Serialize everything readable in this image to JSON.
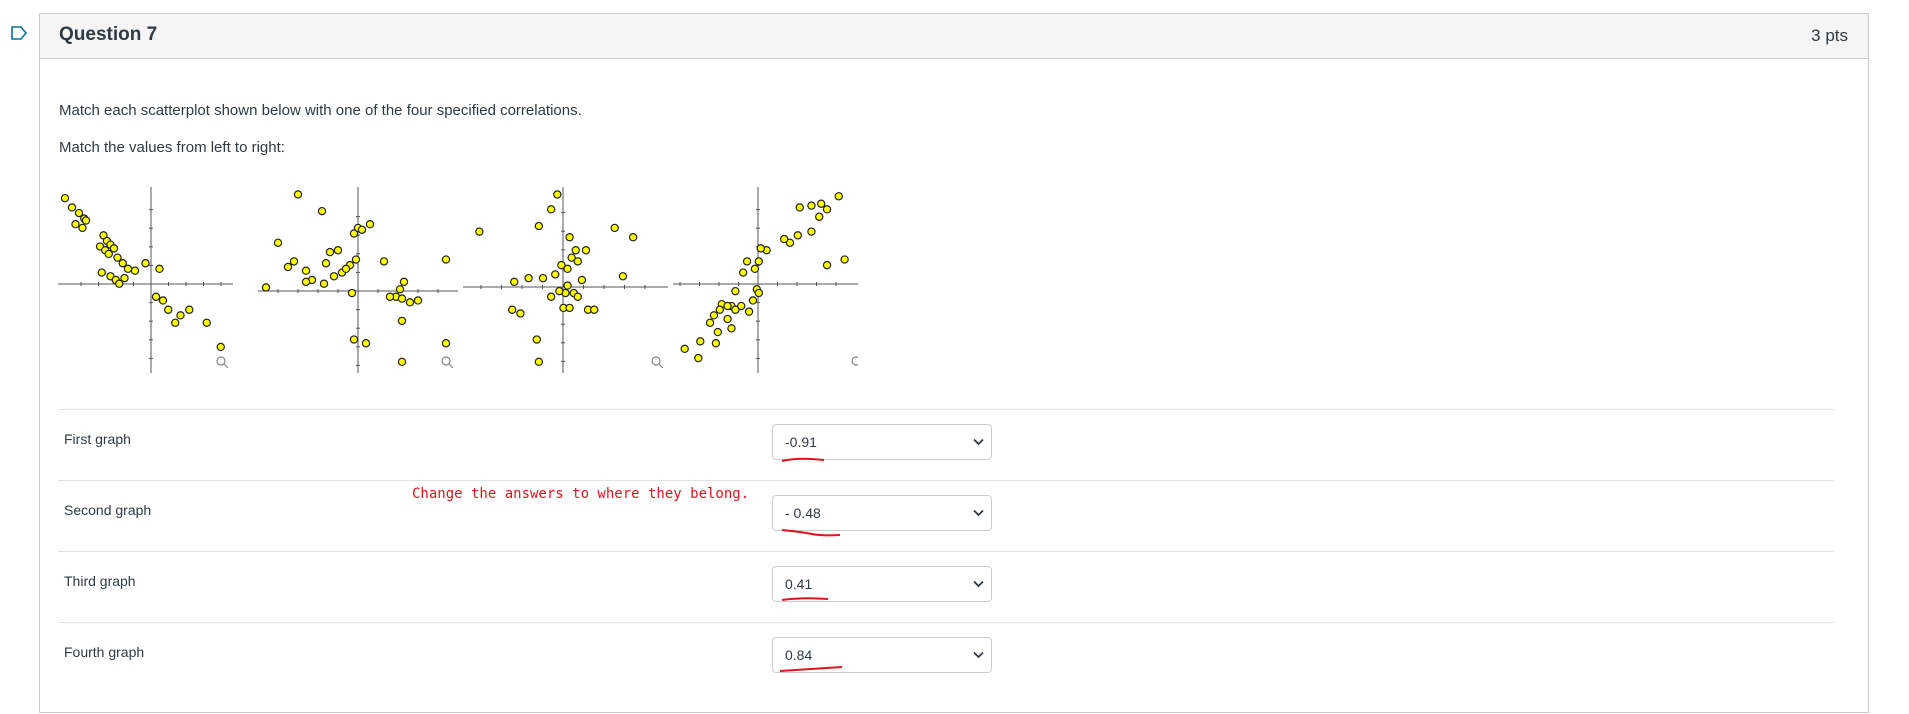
{
  "question": {
    "title": "Question 7",
    "points": "3 pts",
    "prompt": "Match each scatterplot shown below with one of the four specified correlations.",
    "instruction": "Match the values from left to right:"
  },
  "rows": [
    {
      "label": "First graph",
      "selected": "-0.91"
    },
    {
      "label": "Second graph",
      "selected": "- 0.48"
    },
    {
      "label": "Third graph",
      "selected": "0.41"
    },
    {
      "label": "Fourth graph",
      "selected": "0.84"
    }
  ],
  "annotation": {
    "note": "Change the answers to where they belong.",
    "color": "#e1141b"
  },
  "colors": {
    "point_fill": "#ffff00",
    "point_stroke": "#222222",
    "flag": "#0770a3"
  },
  "icons": [
    "flag-icon",
    "chevron-down-icon",
    "magnifier-icon"
  ],
  "chart_data": [
    {
      "type": "scatter",
      "title": "",
      "xlabel": "",
      "ylabel": "",
      "xlim": [
        -5,
        5
      ],
      "ylim": [
        -5,
        5
      ],
      "grid": false,
      "x": [
        -4.6,
        -4.2,
        -3.8,
        -3.5,
        -4.0,
        -3.6,
        -3.4,
        -2.4,
        -2.2,
        -2.0,
        -2.6,
        -2.3,
        -1.8,
        -2.1,
        -1.6,
        -1.3,
        -1.0,
        -2.5,
        -2.0,
        -1.7,
        -1.5,
        -1.2,
        -0.6,
        0.0,
        0.8,
        0.6,
        1.0,
        1.3,
        2.0,
        2.5,
        1.7,
        3.5,
        4.3
      ],
      "y": [
        4.4,
        3.9,
        3.6,
        3.3,
        3.0,
        2.8,
        3.2,
        2.4,
        2.1,
        1.9,
        1.8,
        1.6,
        1.7,
        1.4,
        1.2,
        0.9,
        0.6,
        0.4,
        0.2,
        0.0,
        -0.2,
        0.1,
        0.5,
        0.9,
        0.6,
        -0.9,
        -1.1,
        -1.6,
        -1.9,
        -1.6,
        -2.3,
        -2.3,
        -3.6
      ]
    },
    {
      "type": "scatter",
      "title": "",
      "xlabel": "",
      "ylabel": "",
      "xlim": [
        -5,
        5
      ],
      "ylim": [
        -5,
        5
      ],
      "grid": false,
      "x": [
        -3.0,
        -1.8,
        -4.0,
        -3.5,
        -3.2,
        -2.6,
        -2.3,
        -1.6,
        -1.4,
        -1.0,
        -0.8,
        -0.4,
        -0.2,
        0.0,
        0.2,
        0.6,
        -1.2,
        -0.6,
        -0.1,
        -2.6,
        -1.7,
        -0.3,
        1.3,
        2.3,
        2.1,
        1.9,
        2.2,
        2.6,
        3.0,
        4.4,
        1.6,
        2.2,
        -0.2,
        0.4,
        2.2,
        4.4,
        -4.6
      ],
      "y": [
        4.6,
        3.7,
        2.0,
        0.7,
        1.0,
        0.5,
        0.0,
        0.9,
        1.5,
        1.6,
        0.4,
        0.8,
        2.5,
        2.8,
        2.7,
        3.0,
        0.2,
        0.6,
        1.1,
        -0.1,
        -0.2,
        -0.7,
        1.0,
        -0.1,
        -0.5,
        -0.9,
        -1.0,
        -1.2,
        -1.1,
        1.1,
        -0.9,
        -2.2,
        -3.2,
        -3.4,
        -4.4,
        -3.4,
        -0.4
      ]
    },
    {
      "type": "scatter",
      "title": "",
      "xlabel": "",
      "ylabel": "",
      "xlim": [
        -5,
        5
      ],
      "ylim": [
        -5,
        5
      ],
      "grid": false,
      "x": [
        -4.2,
        -1.3,
        -0.7,
        -0.4,
        0.2,
        0.5,
        1.0,
        2.4,
        3.3,
        0.3,
        0.6,
        0.1,
        -0.2,
        -0.5,
        -1.1,
        -1.8,
        -2.5,
        0.8,
        2.8,
        0.1,
        0.0,
        -0.3,
        0.4,
        0.6,
        -0.7,
        -0.1,
        0.2,
        1.1,
        1.4,
        -2.2,
        -2.6,
        -1.4,
        -1.3
      ],
      "y": [
        2.6,
        2.9,
        3.8,
        4.6,
        2.3,
        1.6,
        1.6,
        2.8,
        2.3,
        1.2,
        1.0,
        0.6,
        0.8,
        0.3,
        0.1,
        0.1,
        -0.1,
        0.0,
        0.2,
        -0.3,
        -0.7,
        -0.6,
        -0.7,
        -0.9,
        -0.9,
        -1.5,
        -1.5,
        -1.6,
        -1.6,
        -1.8,
        -1.6,
        -3.2,
        -4.4
      ]
    },
    {
      "type": "scatter",
      "title": "",
      "xlabel": "",
      "ylabel": "",
      "xlim": [
        -5,
        5
      ],
      "ylim": [
        -5,
        5
      ],
      "grid": false,
      "x": [
        1.5,
        2.1,
        3.5,
        2.6,
        2.9,
        2.5,
        2.1,
        1.4,
        1.0,
        0.7,
        -0.2,
        -0.5,
        -0.6,
        -1.2,
        -0.8,
        -1.4,
        -0.7,
        -0.6,
        -1.8,
        -2.0,
        -2.5,
        -2.2,
        -1.8,
        -2.6,
        -2.9,
        -3.1,
        -2.2,
        -1.5,
        -1.1,
        -0.9,
        -2.0,
        -2.7,
        -3.6,
        -2.8,
        -4.4,
        -3.7,
        3.8,
        2.9
      ],
      "y": [
        3.9,
        4.0,
        4.5,
        4.1,
        3.8,
        3.4,
        2.6,
        2.4,
        2.0,
        2.2,
        1.6,
        1.7,
        1.0,
        1.0,
        0.6,
        0.4,
        -0.5,
        -0.7,
        -0.6,
        -1.4,
        -1.3,
        -1.4,
        -1.6,
        -1.6,
        -1.9,
        -2.3,
        -2.1,
        -1.4,
        -1.7,
        -1.1,
        -2.6,
        -2.8,
        -3.3,
        -3.4,
        -3.7,
        -4.2,
        1.1,
        0.8
      ]
    }
  ]
}
